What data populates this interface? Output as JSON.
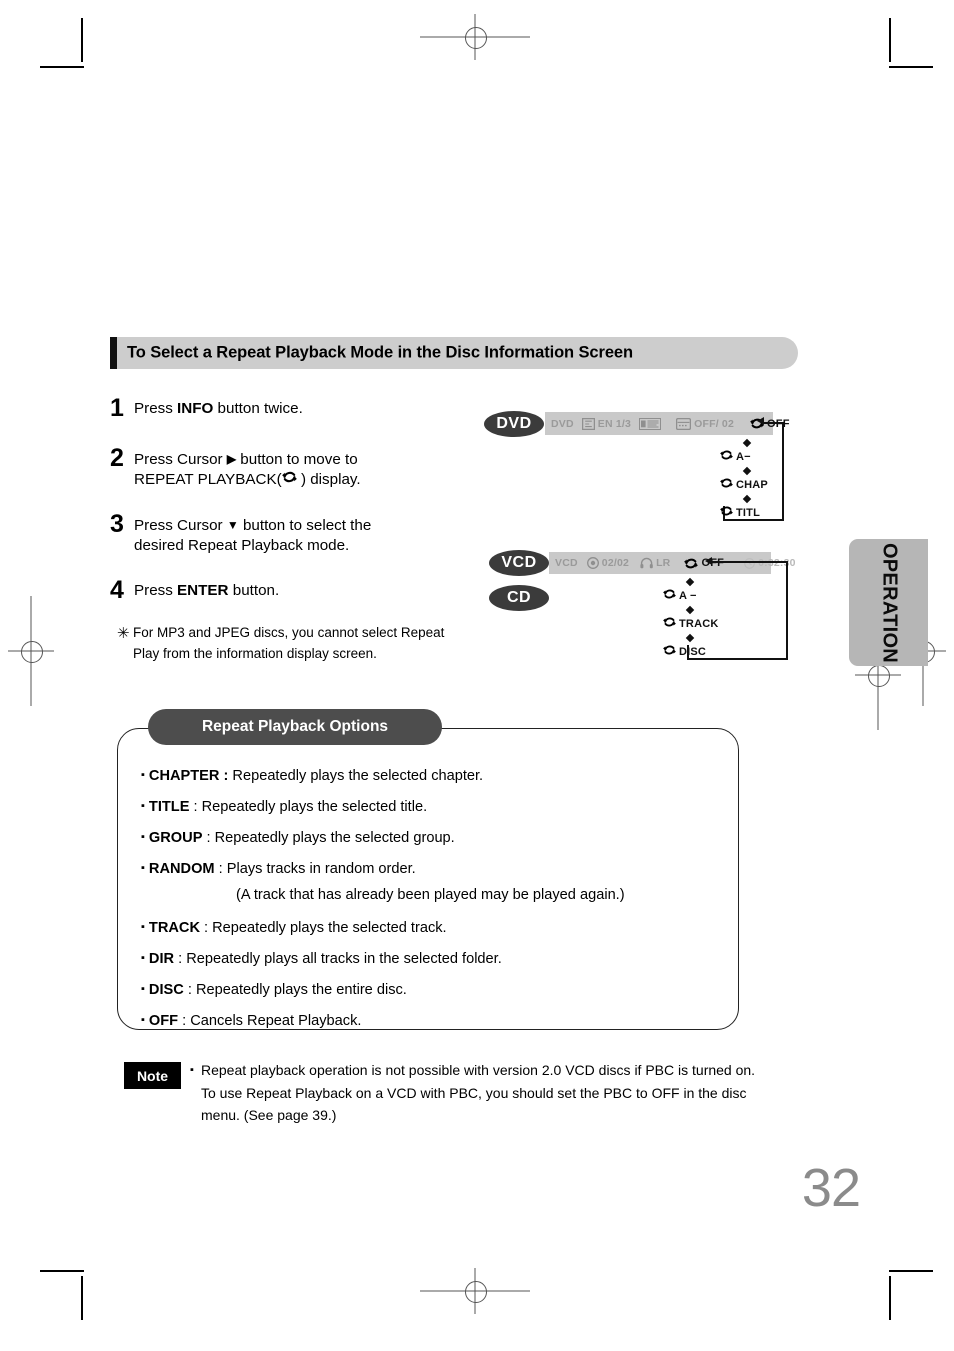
{
  "page": {
    "number": "32",
    "side_tab_label": "OPERATION"
  },
  "section": {
    "title": "To Select a Repeat Playback Mode in the Disc Information Screen"
  },
  "steps": [
    {
      "num": "1",
      "line1_pre": "Press ",
      "line1_bold": "INFO",
      "line1_post": " button twice.",
      "line2_pre": "",
      "line2_post": ""
    },
    {
      "num": "2",
      "line1_pre": "Press Cursor ",
      "line1_bold": "▶",
      "line1_post": " button to move to",
      "line2_pre": "REPEAT PLAYBACK(",
      "line2_post": " ) display."
    },
    {
      "num": "3",
      "line1_pre": "Press Cursor ",
      "line1_bold": "▼",
      "line1_post": " button to select the",
      "line2_pre": "desired Repeat Playback mode.",
      "line2_post": ""
    },
    {
      "num": "4",
      "line1_pre": "Press ",
      "line1_bold": "ENTER",
      "line1_post": " button.",
      "line2_pre": "",
      "line2_post": ""
    }
  ],
  "footnote": {
    "marker": "✳",
    "line1": "For MP3 and JPEG discs, you cannot select Repeat",
    "line2": "Play from the information display screen."
  },
  "diagrams": {
    "dvd": {
      "badges": [
        "DVD"
      ],
      "osd_items": [
        {
          "label": "DVD",
          "icon": "none",
          "active": false
        },
        {
          "label": "EN 1/3",
          "icon": "subtitle-icon",
          "active": false
        },
        {
          "label": "",
          "icon": "dolby-digital-icon",
          "active": false
        },
        {
          "label": "OFF/ 02",
          "icon": "angle-icon",
          "active": false
        },
        {
          "label": "OFF",
          "icon": "repeat-icon",
          "active": true
        }
      ],
      "options": [
        "A−",
        "CHAP",
        "TITL"
      ],
      "first_option": "OFF"
    },
    "vcd_cd": {
      "badges": [
        "VCD",
        "CD"
      ],
      "osd_items": [
        {
          "label": "VCD",
          "icon": "none",
          "active": false
        },
        {
          "label": "02/02",
          "icon": "track-icon",
          "active": false
        },
        {
          "label": "LR",
          "icon": "audio-icon",
          "active": false
        },
        {
          "label": "OFF",
          "icon": "repeat-icon",
          "active": true
        },
        {
          "label": "0:32:30",
          "icon": "clock-icon",
          "active": false
        }
      ],
      "options": [
        "A −",
        "TRACK",
        "DISC"
      ],
      "first_option": "OFF"
    }
  },
  "options_panel": {
    "title": "Repeat Playback Options",
    "items": [
      {
        "term": "CHAPTER :",
        "desc": " Repeatedly plays the selected chapter."
      },
      {
        "term": "TITLE",
        "desc": " : Repeatedly plays the selected title."
      },
      {
        "term": "GROUP",
        "desc": " : Repeatedly plays the selected group."
      },
      {
        "term": "RANDOM",
        "desc": " : Plays tracks in random order."
      },
      {
        "term": "TRACK",
        "desc": " : Repeatedly plays the selected track."
      },
      {
        "term": "DIR",
        "desc": " : Repeatedly plays all tracks in the selected folder."
      },
      {
        "term": "DISC",
        "desc": " : Repeatedly plays the entire disc."
      },
      {
        "term": "OFF",
        "desc": " : Cancels Repeat Playback."
      }
    ],
    "random_subline": "(A track that has already been played may be played again.)"
  },
  "note": {
    "label": "Note",
    "line1": "Repeat playback operation is not possible with version 2.0 VCD discs if PBC is turned on.",
    "line2": "To use Repeat Playback on a VCD with PBC, you should set the PBC to OFF in the disc",
    "line3": "menu. (See page 39.)"
  },
  "colors": {
    "header_bar": "#cdcdcd",
    "pill": "#4d4d4d",
    "badge": "#3b3b3b",
    "osd_bar": "#c9c9c9",
    "side_tab": "#b6b6b6",
    "page_number": "#8b8b8b"
  }
}
